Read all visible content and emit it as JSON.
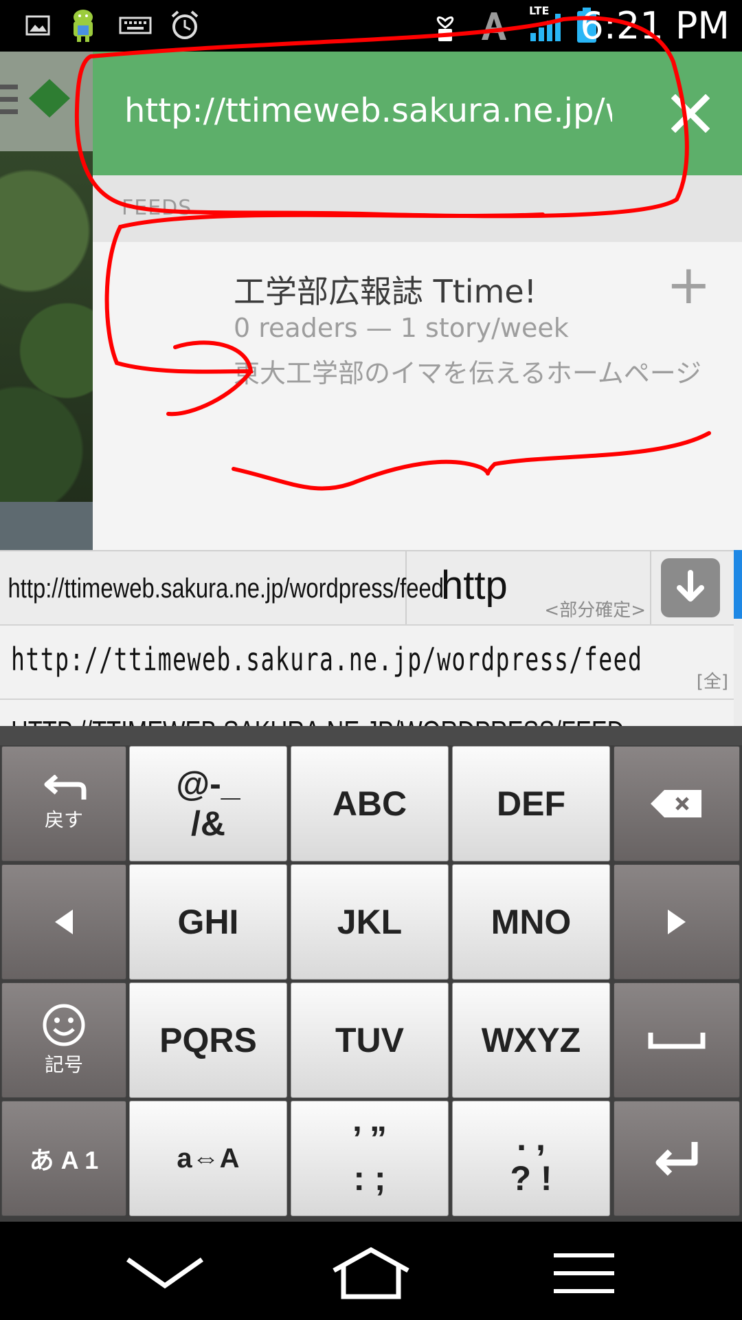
{
  "status_bar": {
    "time": "6:21 PM",
    "network_label": "LTE",
    "icons": [
      "image-icon",
      "android-icon",
      "keyboard-icon",
      "alarm-icon",
      "heart-phone-icon",
      "a-icon",
      "signal-icon",
      "battery-icon"
    ]
  },
  "panel": {
    "url": "http://ttimeweb.sakura.ne.jp/wordpress/feed",
    "close_icon": "close-icon",
    "section_label": "FEEDS",
    "feed": {
      "title": "工学部広報誌 Ttime!",
      "meta": "0 readers — 1 story/week",
      "description": "東大工学部のイマを伝えるホームページ",
      "add_label": "+"
    }
  },
  "candidates": {
    "left_text": "http://ttimeweb.sakura.ne.jp/wordpress/feed",
    "mid_text": "http",
    "mid_tag": "<部分確定>",
    "full_text": "http://ttimeweb.sakura.ne.jp/wordpress/feed",
    "full_tag": "[全]",
    "upper_text": "HTTP://TTIMEWEB.SAKURA.NE.JP/WORDPRESS/FEED"
  },
  "keyboard": {
    "undo_label": "戻す",
    "k_symbols_top": "@-_",
    "k_symbols_bottom": "/&",
    "k_abc": "ABC",
    "k_def": "DEF",
    "k_ghi": "GHI",
    "k_jkl": "JKL",
    "k_mno": "MNO",
    "emoji_label": "記号",
    "k_pqrs": "PQRS",
    "k_tuv": "TUV",
    "k_wxyz": "WXYZ",
    "mode_label": "あ A 1",
    "case_label": "a⇔A",
    "punct1_top": "’ ”",
    "punct1_bottom": ": ;",
    "punct2_top": ". ,",
    "punct2_bottom": "? !"
  },
  "colors": {
    "header_green": "#5daf6a",
    "annotation_red": "#ff0000"
  }
}
